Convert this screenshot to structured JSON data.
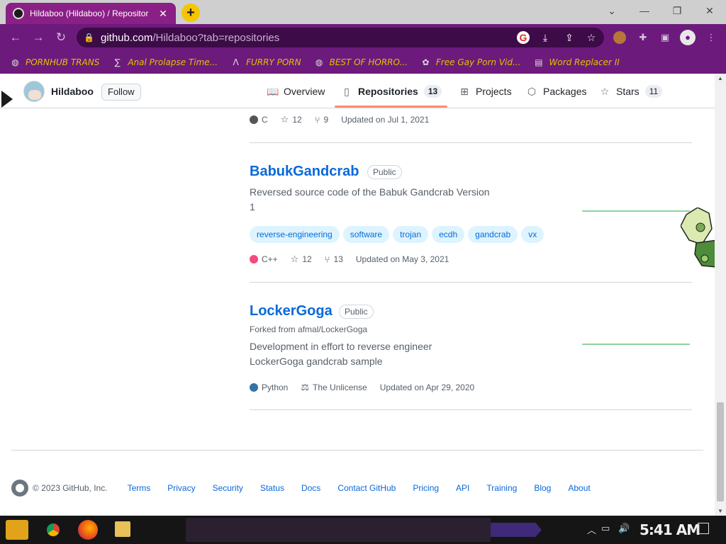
{
  "browser": {
    "tab_title": "Hildaboo (Hildaboo) / Repositor",
    "tab_close": "✕",
    "new_tab": "+",
    "url_host": "github.com",
    "url_path": "/Hildaboo?tab=repositories"
  },
  "bookmarks": [
    {
      "label": "PORNHUB TRANS",
      "icon": "globe-icon"
    },
    {
      "label": "Anal Prolapse Time...",
      "icon": "tube-icon"
    },
    {
      "label": "FURRY PORN",
      "icon": "lambda-icon"
    },
    {
      "label": "BEST OF HORRO...",
      "icon": "globe-icon"
    },
    {
      "label": "Free Gay Porn Vid...",
      "icon": "extension-icon"
    },
    {
      "label": "Word Replacer II",
      "icon": "wr-icon"
    }
  ],
  "profile": {
    "name": "Hildaboo",
    "follow_label": "Follow"
  },
  "tabs": [
    {
      "label": "Overview",
      "icon": "book-icon"
    },
    {
      "label": "Repositories",
      "icon": "repo-icon",
      "count": "13"
    },
    {
      "label": "Projects",
      "icon": "table-icon"
    },
    {
      "label": "Packages",
      "icon": "package-icon"
    },
    {
      "label": "Stars",
      "icon": "star-icon",
      "count": "11"
    }
  ],
  "top_meta": {
    "language": "C",
    "language_color": "#555555",
    "stars": "12",
    "forks": "9",
    "updated": "Updated on Jul 1, 2021"
  },
  "repos": [
    {
      "name": "BabukGandcrab",
      "visibility": "Public",
      "description": "Reversed source code of the Babuk Gandcrab Version 1",
      "topics": [
        "reverse-engineering",
        "software",
        "trojan",
        "ecdh",
        "gandcrab",
        "vx"
      ],
      "language": "C++",
      "language_color": "#f34b7d",
      "stars": "12",
      "forks": "13",
      "updated": "Updated on May 3, 2021"
    },
    {
      "name": "LockerGoga",
      "visibility": "Public",
      "forked_from": "Forked from afmal/LockerGoga",
      "description": "Development in effort to reverse engineer LockerGoga gandcrab sample",
      "language": "Python",
      "language_color": "#3572A5",
      "license": "The Unlicense",
      "updated": "Updated on Apr 29, 2020"
    }
  ],
  "footer": {
    "copyright": "© 2023 GitHub, Inc.",
    "links": [
      "Terms",
      "Privacy",
      "Security",
      "Status",
      "Docs",
      "Contact GitHub",
      "Pricing",
      "API",
      "Training",
      "Blog",
      "About"
    ]
  },
  "taskbar": {
    "clock": "5:41 AM"
  },
  "colors": {
    "link": "#0969da",
    "accent_tab": "#fd8c73",
    "browser_theme": "#6d1a7d"
  }
}
